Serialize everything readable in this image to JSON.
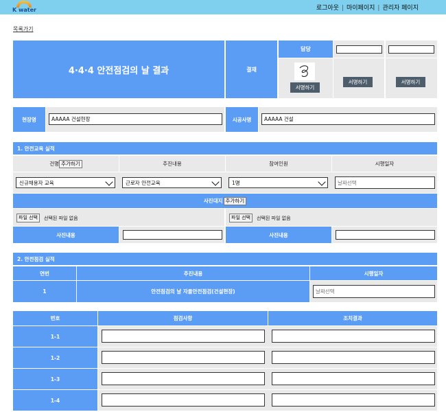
{
  "header": {
    "logo_text": "K water",
    "nav": [
      "로그아웃",
      "마이페이지",
      "관리자 페이지"
    ]
  },
  "back_link": "목록가기",
  "title": "4·4·4 안전점검의 날 결과",
  "approval": {
    "label": "결재",
    "owner_label": "담당",
    "sign_buttons": [
      "서명하기",
      "서명하기",
      "서명하기"
    ]
  },
  "site": {
    "site_label": "현장명",
    "site_value": "AAAAA 건설현장",
    "builder_label": "시공사명",
    "builder_value": "AAAAA 건설"
  },
  "section1": {
    "title": "1. 안전교육 실적",
    "columns": [
      "건명",
      "추진내용",
      "참여인원",
      "시행일자"
    ],
    "add_label": "추가하기",
    "row": {
      "name": "신규채용자 교육",
      "content": "근로자 안전교육",
      "people": "1명",
      "date_placeholder": "날짜선택"
    },
    "photo_header": "사진대지",
    "photo_add": "추가하기",
    "file_button": "파일 선택",
    "file_status": "선택된 파일 없음",
    "photo_content_label": "사진내용"
  },
  "section2": {
    "title": "2. 안전점검 실적",
    "columns": [
      "연번",
      "추진내용",
      "시행일자"
    ],
    "row": {
      "no": "1",
      "content": "안전점검의 날 자율안전점검(건설현장)",
      "date_placeholder": "날짜선택"
    }
  },
  "inspection": {
    "columns": [
      "번호",
      "점검사항",
      "조치결과"
    ],
    "rows": [
      "1-1",
      "1-2",
      "1-3",
      "1-4"
    ]
  },
  "colors": {
    "accent": "#5b9cf5",
    "topbar": "#7fcfee",
    "cell_gray": "#e9e9e9",
    "button_dark": "#4e5d6b"
  }
}
